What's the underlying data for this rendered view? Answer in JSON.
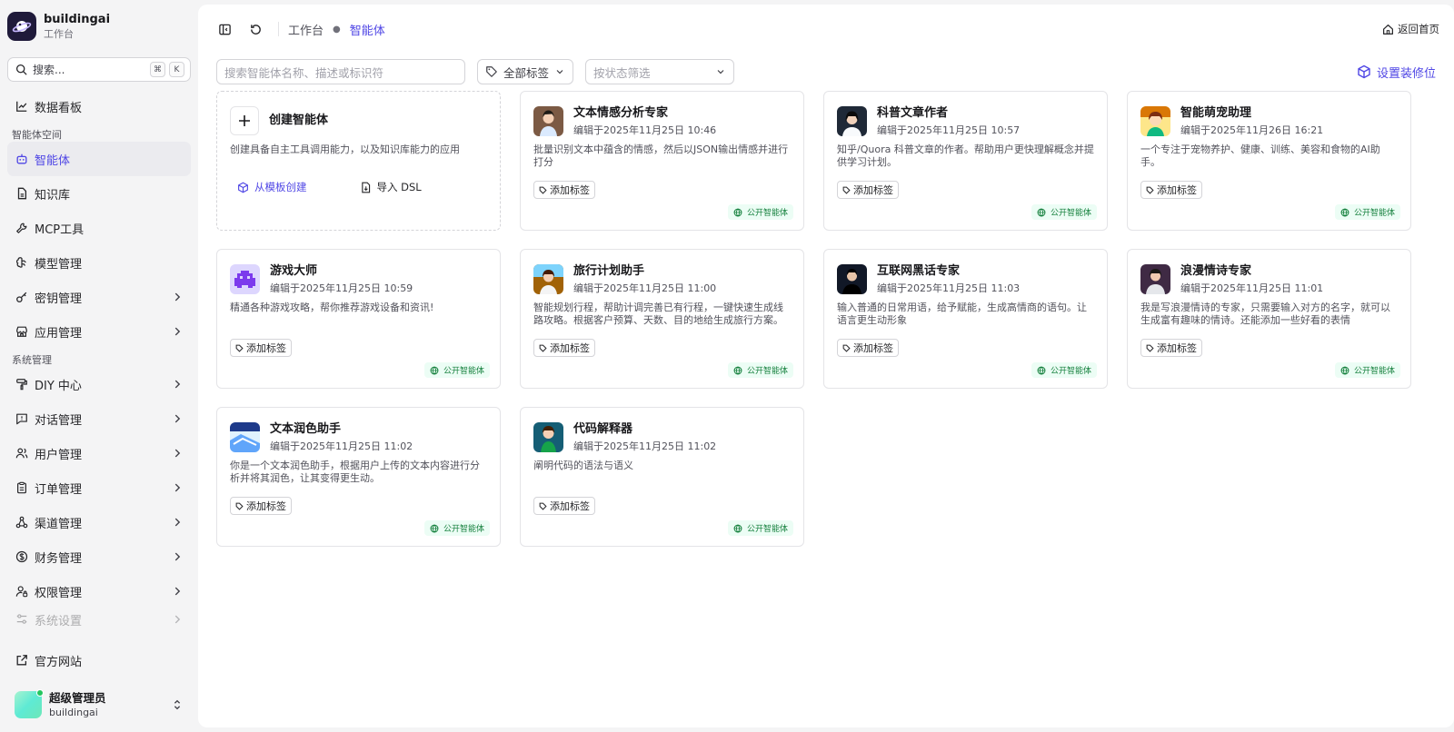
{
  "brand": {
    "name": "buildingai",
    "subtitle": "工作台"
  },
  "search": {
    "label": "搜索...",
    "kbd1": "⌘",
    "kbd2": "K"
  },
  "sidebar": {
    "items": [
      {
        "label": "数据看板",
        "icon": "chart-line-icon"
      },
      {
        "label": "智能体",
        "icon": "bot-icon",
        "active": true
      },
      {
        "label": "知识库",
        "icon": "file-icon"
      },
      {
        "label": "MCP工具",
        "icon": "wrench-icon"
      },
      {
        "label": "模型管理",
        "icon": "brain-icon"
      },
      {
        "label": "密钥管理",
        "icon": "key-icon"
      },
      {
        "label": "应用管理",
        "icon": "store-icon"
      },
      {
        "label": "DIY 中心",
        "icon": "paint-roller-icon"
      },
      {
        "label": "对话管理",
        "icon": "message-icon"
      },
      {
        "label": "用户管理",
        "icon": "users-icon"
      },
      {
        "label": "订单管理",
        "icon": "clipboard-icon"
      },
      {
        "label": "渠道管理",
        "icon": "network-icon"
      },
      {
        "label": "财务管理",
        "icon": "coin-icon"
      },
      {
        "label": "权限管理",
        "icon": "user-lock-icon"
      },
      {
        "label": "系统设置",
        "icon": "settings-icon"
      }
    ],
    "group_space": "智能体空间",
    "group_system": "系统管理",
    "official_site": "官方网站"
  },
  "user": {
    "name": "超级管理员",
    "account": "buildingai"
  },
  "breadcrumb": {
    "root": "工作台",
    "current": "智能体"
  },
  "home_link": "返回首页",
  "filters": {
    "search_placeholder": "搜索智能体名称、描述或标识符",
    "tag_select": "全部标签",
    "status_placeholder": "按状态筛选",
    "setting_button": "设置装修位"
  },
  "create_card": {
    "title": "创建智能体",
    "desc": "创建具备自主工具调用能力，以及知识库能力的应用",
    "from_template": "从模板创建",
    "import_dsl": "导入 DSL"
  },
  "card_common": {
    "add_tag": "添加标签",
    "public_badge": "公开智能体"
  },
  "agents": [
    {
      "title": "文本情感分析专家",
      "time": "编辑于2025年11月25日 10:46",
      "desc": "批量识别文本中蕴含的情感，然后以JSON输出情感并进行打分",
      "color": "#7c5a44"
    },
    {
      "title": "科普文章作者",
      "time": "编辑于2025年11月25日 10:57",
      "desc": "知乎/Quora 科普文章的作者。帮助用户更快理解概念并提供学习计划。",
      "color": "#1f2937"
    },
    {
      "title": "智能萌宠助理",
      "time": "编辑于2025年11月26日 16:21",
      "desc": "一个专注于宠物养护、健康、训练、美容和食物的AI助手。",
      "color": "#d97706"
    },
    {
      "title": "游戏大师",
      "time": "编辑于2025年11月25日 10:59",
      "desc": "精通各种游戏攻略，帮你推荐游戏设备和资讯!",
      "color": "#a78bfa"
    },
    {
      "title": "旅行计划助手",
      "time": "编辑于2025年11月25日 11:00",
      "desc": "智能规划行程，帮助计调完善已有行程，一键快速生成线路攻略。根据客户预算、天数、目的地给生成旅行方案。",
      "color": "#92400e"
    },
    {
      "title": "互联网黑话专家",
      "time": "编辑于2025年11月25日 11:03",
      "desc": "输入普通的日常用语，给予赋能，生成高情商的语句。让语言更生动形象",
      "color": "#111827"
    },
    {
      "title": "浪漫情诗专家",
      "time": "编辑于2025年11月25日 11:01",
      "desc": "我是写浪漫情诗的专家，只需要输入对方的名字，就可以生成富有趣味的情诗。还能添加一些好看的表情",
      "color": "#3f2a44"
    },
    {
      "title": "文本润色助手",
      "time": "编辑于2025年11月25日 11:02",
      "desc": "你是一个文本润色助手，根据用户上传的文本内容进行分析并将其润色，让其变得更生动。",
      "color": "#60a5fa"
    },
    {
      "title": "代码解释器",
      "time": "编辑于2025年11月25日 11:02",
      "desc": "阐明代码的语法与语义",
      "color": "#155e75"
    }
  ]
}
